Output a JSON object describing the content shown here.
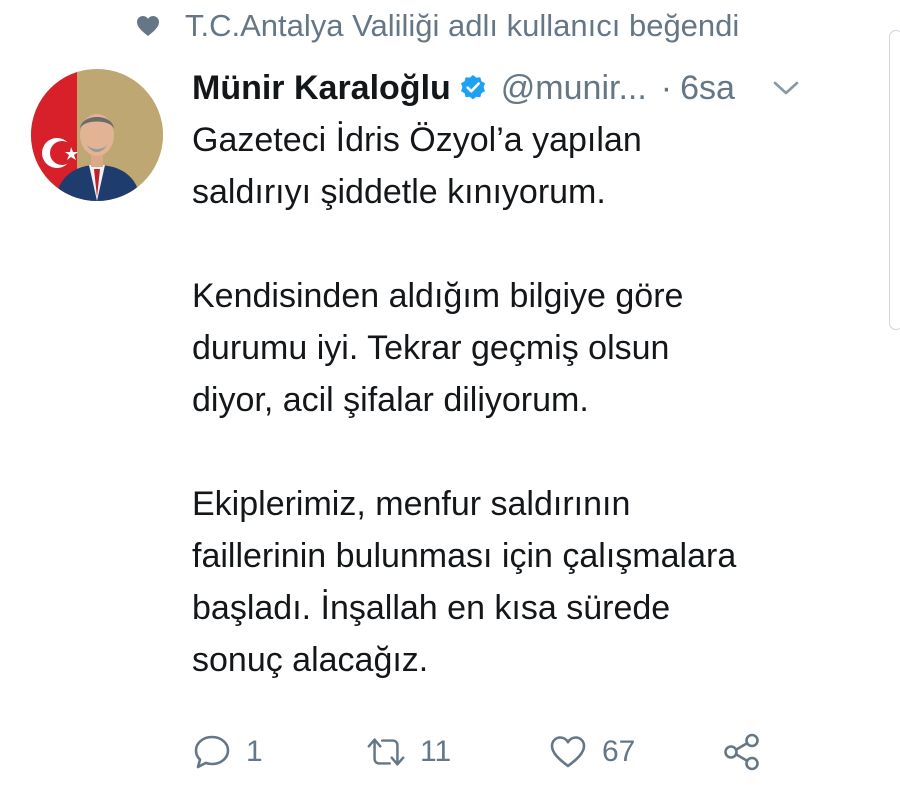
{
  "social_context": {
    "icon": "heart-icon",
    "text": "T.C.Antalya Valiliği adlı kullanıcı beğendi"
  },
  "tweet": {
    "author_name": "Münir Karaloğlu",
    "verified": true,
    "handle": "@munir...",
    "separator": "·",
    "time": "6sa",
    "paragraphs": [
      [
        "Gazeteci İdris Özyol’a yapılan",
        "saldırıyı şiddetle kınıyorum."
      ],
      [
        "Kendisinden aldığım bilgiye göre",
        "durumu iyi. Tekrar geçmiş olsun",
        "diyor, acil şifalar diliyorum."
      ],
      [
        "Ekiplerimiz, menfur saldırının",
        "faillerinin bulunması için çalışmalara",
        "başladı. İnşallah en kısa sürede",
        "sonuç alacağız."
      ]
    ]
  },
  "actions": {
    "reply_count": "1",
    "retweet_count": "11",
    "like_count": "67"
  },
  "colors": {
    "text": "#14171a",
    "muted": "#657786",
    "verified_blue": "#1da1f2"
  }
}
